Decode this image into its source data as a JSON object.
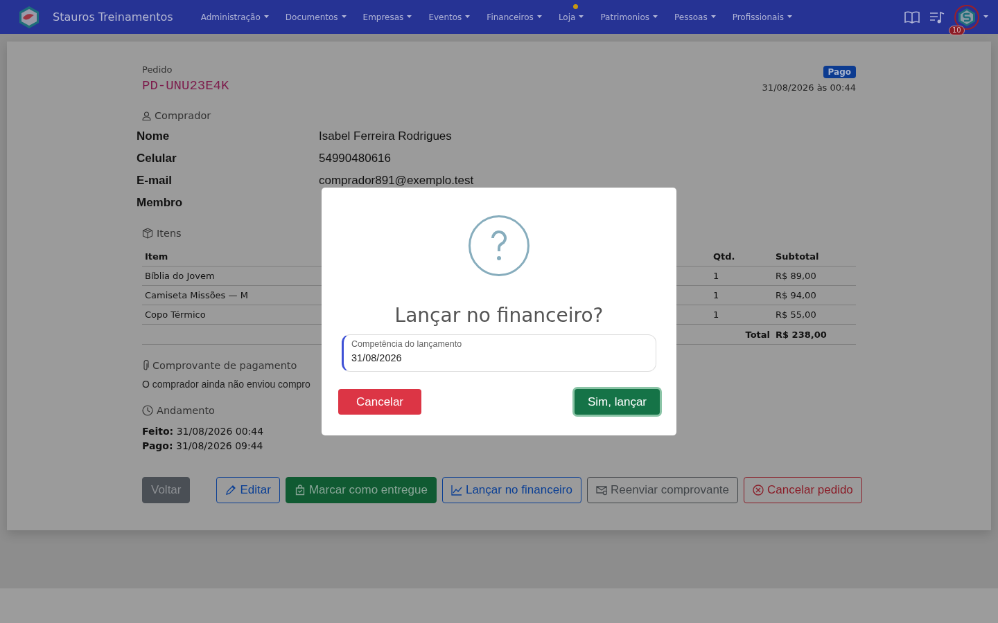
{
  "navbar": {
    "brand": "Stauros Treinamentos",
    "menu": [
      {
        "label": "Administração",
        "notification": false
      },
      {
        "label": "Documentos",
        "notification": false
      },
      {
        "label": "Empresas",
        "notification": false
      },
      {
        "label": "Eventos",
        "notification": false
      },
      {
        "label": "Financeiros",
        "notification": false
      },
      {
        "label": "Loja",
        "notification": true
      },
      {
        "label": "Patrimonios",
        "notification": false
      },
      {
        "label": "Pessoas",
        "notification": false
      },
      {
        "label": "Profissionais",
        "notification": false
      }
    ],
    "avatar_badge": "10"
  },
  "order": {
    "label": "Pedido",
    "code": "PD-UNU23E4K",
    "status": "Pago",
    "datetime": "31/08/2026 às 00:44"
  },
  "buyer": {
    "heading": "Comprador",
    "fields": [
      {
        "label": "Nome",
        "value": "Isabel Ferreira Rodrigues"
      },
      {
        "label": "Celular",
        "value": "54990480616"
      },
      {
        "label": "E-mail",
        "value": "comprador891@exemplo.test"
      },
      {
        "label": "Membro"
      }
    ]
  },
  "items": {
    "heading": "Itens",
    "columns": [
      "Item",
      "Qtd.",
      "Subtotal"
    ],
    "rows": [
      {
        "item": "Bíblia do Jovem",
        "qty": "1",
        "subtotal": "R$ 89,00"
      },
      {
        "item": "Camiseta Missões — M",
        "qty": "1",
        "subtotal": "R$ 94,00"
      },
      {
        "item": "Copo Térmico",
        "qty": "1",
        "subtotal": "R$ 55,00"
      }
    ],
    "total_label": "Total",
    "total_value": "R$ 238,00"
  },
  "payment_proof": {
    "heading": "Comprovante de pagamento",
    "message": "O comprador ainda não enviou compro"
  },
  "progress": {
    "heading": "Andamento",
    "entries": [
      {
        "label": "Feito:",
        "value": "31/08/2026 00:44"
      },
      {
        "label": "Pago:",
        "value": "31/08/2026 09:44"
      }
    ]
  },
  "actions": [
    {
      "label": "Voltar",
      "kind": "secondary"
    },
    {
      "label": "Editar",
      "kind": "outline-primary"
    },
    {
      "label": "Marcar como entregue",
      "kind": "success"
    },
    {
      "label": "Lançar no financeiro",
      "kind": "outline-primary"
    },
    {
      "label": "Reenviar comprovante",
      "kind": "outline-secondary"
    },
    {
      "label": "Cancelar pedido",
      "kind": "outline-danger"
    }
  ],
  "dialog": {
    "title": "Lançar no financeiro?",
    "field_label": "Competência do lançamento",
    "field_value": "31/08/2026",
    "buttons": [
      {
        "label": "Cancelar",
        "kind": "danger",
        "focused": false
      },
      {
        "label": "Sim, lançar",
        "kind": "success",
        "focused": true
      }
    ]
  }
}
